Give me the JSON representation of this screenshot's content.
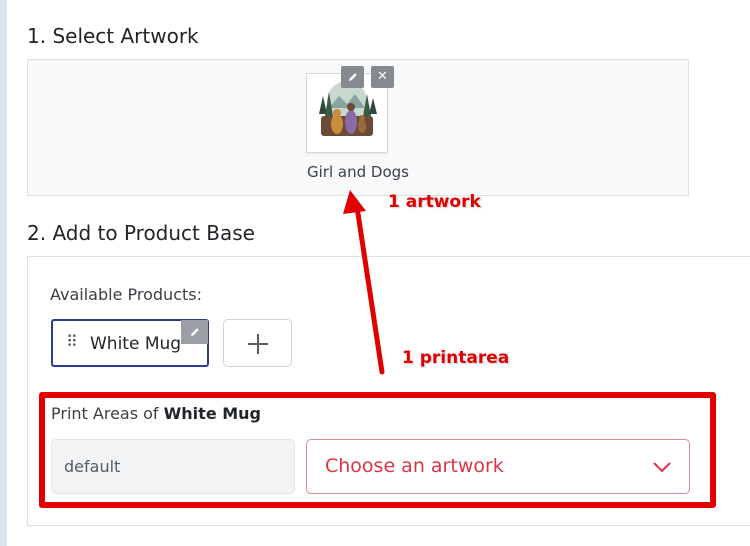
{
  "sections": {
    "select_artwork": {
      "title": "1. Select Artwork"
    },
    "add_to_product": {
      "title": "2. Add to Product Base"
    }
  },
  "artwork": {
    "name": "Girl and Dogs",
    "edit_icon": "pencil-icon",
    "remove_icon": "close-icon"
  },
  "products": {
    "label": "Available Products:",
    "items": [
      {
        "label": "White Mug",
        "edit_icon": "pencil-icon",
        "drag_icon": "drag-handle-icon"
      }
    ],
    "add_icon": "plus-icon"
  },
  "print_areas": {
    "title_prefix": "Print Areas of ",
    "product_name": "White Mug",
    "rows": [
      {
        "name": "default",
        "select_placeholder": "Choose an artwork"
      }
    ]
  },
  "annotations": {
    "artwork": "1 artwork",
    "printarea": "1 printarea",
    "color": "#e00000"
  }
}
